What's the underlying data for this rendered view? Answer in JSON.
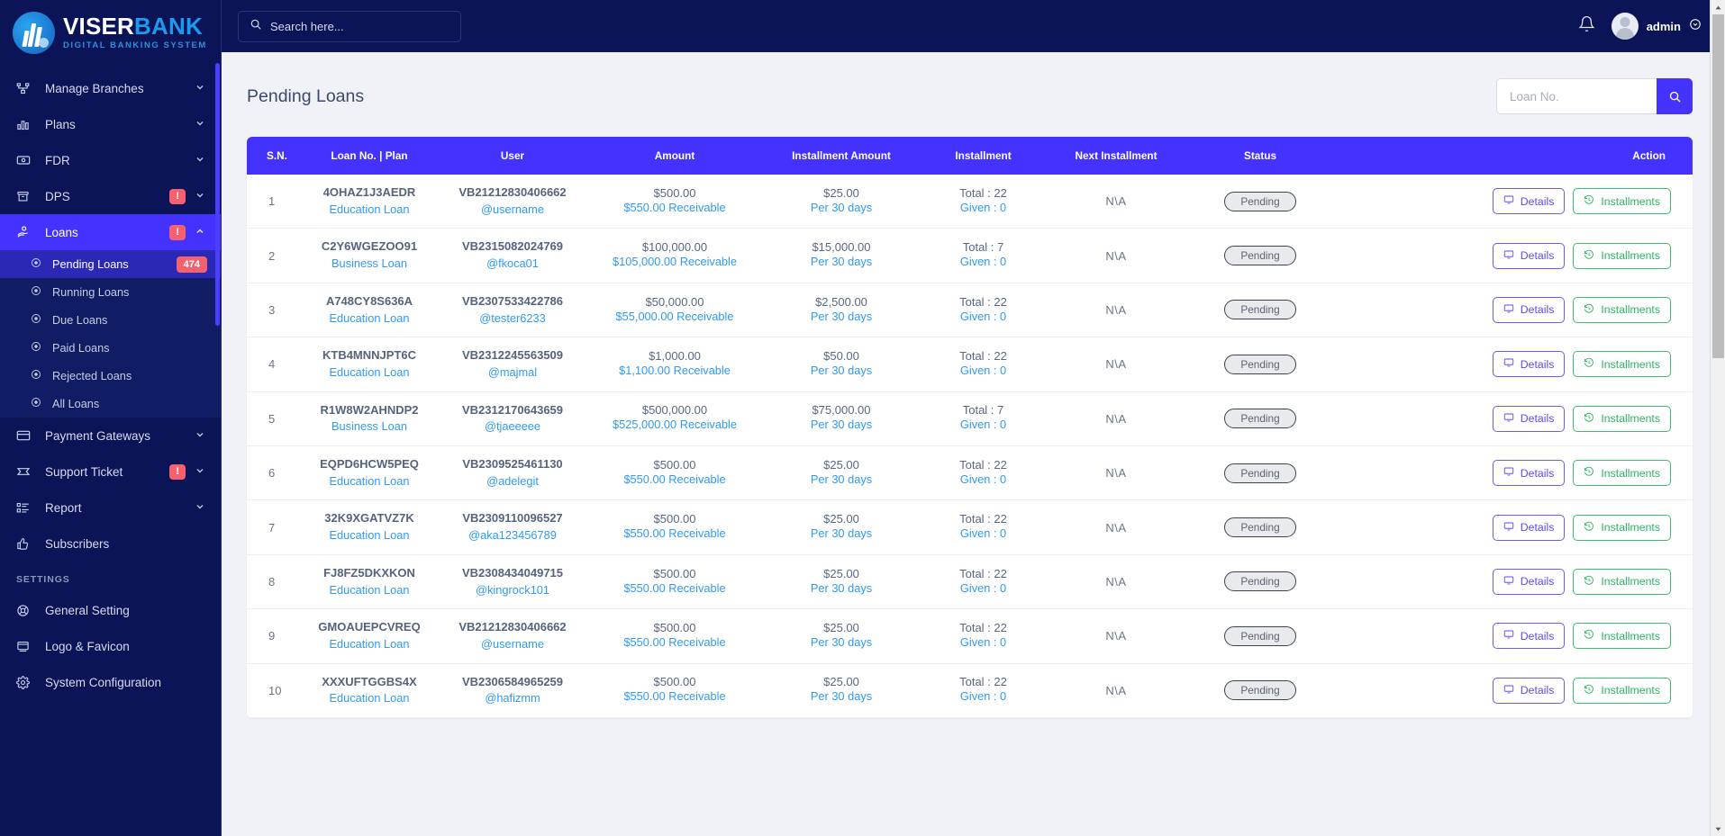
{
  "brand": {
    "word1": "VISER",
    "word2": "BANK",
    "tagline": "DIGITAL BANKING SYSTEM"
  },
  "topbar": {
    "search_placeholder": "Search here...",
    "user_name": "admin"
  },
  "sidebar": {
    "items": [
      {
        "label": "Manage Branches",
        "icon": "sitemap-icon",
        "chevron": true
      },
      {
        "label": "Plans",
        "icon": "bar-chart-icon",
        "chevron": true
      },
      {
        "label": "FDR",
        "icon": "money-icon",
        "chevron": true
      },
      {
        "label": "DPS",
        "icon": "archive-icon",
        "chevron": true,
        "alert": "!"
      },
      {
        "label": "Loans",
        "icon": "hand-coin-icon",
        "chevron": true,
        "alert": "!",
        "active": true
      }
    ],
    "loans_submenu": [
      {
        "label": "Pending Loans",
        "badge": "474",
        "current": true
      },
      {
        "label": "Running Loans"
      },
      {
        "label": "Due Loans"
      },
      {
        "label": "Paid Loans"
      },
      {
        "label": "Rejected Loans"
      },
      {
        "label": "All Loans"
      }
    ],
    "items_after": [
      {
        "label": "Payment Gateways",
        "icon": "credit-card-icon",
        "chevron": true
      },
      {
        "label": "Support Ticket",
        "icon": "ticket-icon",
        "chevron": true,
        "alert": "!"
      },
      {
        "label": "Report",
        "icon": "list-icon",
        "chevron": true
      },
      {
        "label": "Subscribers",
        "icon": "thumbs-up-icon"
      }
    ],
    "settings_title": "SETTINGS",
    "settings_items": [
      {
        "label": "General Setting",
        "icon": "lifebuoy-icon"
      },
      {
        "label": "Logo & Favicon",
        "icon": "window-icon"
      },
      {
        "label": "System Configuration",
        "icon": "gear-icon"
      }
    ]
  },
  "page": {
    "title": "Pending Loans",
    "loan_search_placeholder": "Loan No.",
    "loan_search_value": ""
  },
  "table": {
    "columns": [
      "S.N.",
      "Loan No. | Plan",
      "User",
      "Amount",
      "Installment Amount",
      "Installment",
      "Next Installment",
      "Status",
      "Action"
    ],
    "details_label": "Details",
    "installments_label": "Installments",
    "rows": [
      {
        "sn": "1",
        "loan_no": "4OHAZ1J3AEDR",
        "plan": "Education Loan",
        "user_id": "VB21212830406662",
        "username": "@username",
        "amount": "$500.00",
        "receivable": "$550.00 Receivable",
        "inst_amount": "$25.00",
        "inst_period": "Per 30 days",
        "inst_total": "Total : 22",
        "inst_given": "Given : 0",
        "next_installment": "N\\A",
        "status": "Pending"
      },
      {
        "sn": "2",
        "loan_no": "C2Y6WGEZOO91",
        "plan": "Business Loan",
        "user_id": "VB2315082024769",
        "username": "@fkoca01",
        "amount": "$100,000.00",
        "receivable": "$105,000.00 Receivable",
        "inst_amount": "$15,000.00",
        "inst_period": "Per 30 days",
        "inst_total": "Total : 7",
        "inst_given": "Given : 0",
        "next_installment": "N\\A",
        "status": "Pending"
      },
      {
        "sn": "3",
        "loan_no": "A748CY8S636A",
        "plan": "Education Loan",
        "user_id": "VB2307533422786",
        "username": "@tester6233",
        "amount": "$50,000.00",
        "receivable": "$55,000.00 Receivable",
        "inst_amount": "$2,500.00",
        "inst_period": "Per 30 days",
        "inst_total": "Total : 22",
        "inst_given": "Given : 0",
        "next_installment": "N\\A",
        "status": "Pending"
      },
      {
        "sn": "4",
        "loan_no": "KTB4MNNJPT6C",
        "plan": "Education Loan",
        "user_id": "VB2312245563509",
        "username": "@majmal",
        "amount": "$1,000.00",
        "receivable": "$1,100.00 Receivable",
        "inst_amount": "$50.00",
        "inst_period": "Per 30 days",
        "inst_total": "Total : 22",
        "inst_given": "Given : 0",
        "next_installment": "N\\A",
        "status": "Pending"
      },
      {
        "sn": "5",
        "loan_no": "R1W8W2AHNDP2",
        "plan": "Business Loan",
        "user_id": "VB2312170643659",
        "username": "@tjaeeeee",
        "amount": "$500,000.00",
        "receivable": "$525,000.00 Receivable",
        "inst_amount": "$75,000.00",
        "inst_period": "Per 30 days",
        "inst_total": "Total : 7",
        "inst_given": "Given : 0",
        "next_installment": "N\\A",
        "status": "Pending"
      },
      {
        "sn": "6",
        "loan_no": "EQPD6HCW5PEQ",
        "plan": "Education Loan",
        "user_id": "VB2309525461130",
        "username": "@adelegit",
        "amount": "$500.00",
        "receivable": "$550.00 Receivable",
        "inst_amount": "$25.00",
        "inst_period": "Per 30 days",
        "inst_total": "Total : 22",
        "inst_given": "Given : 0",
        "next_installment": "N\\A",
        "status": "Pending"
      },
      {
        "sn": "7",
        "loan_no": "32K9XGATVZ7K",
        "plan": "Education Loan",
        "user_id": "VB2309110096527",
        "username": "@aka123456789",
        "amount": "$500.00",
        "receivable": "$550.00 Receivable",
        "inst_amount": "$25.00",
        "inst_period": "Per 30 days",
        "inst_total": "Total : 22",
        "inst_given": "Given : 0",
        "next_installment": "N\\A",
        "status": "Pending"
      },
      {
        "sn": "8",
        "loan_no": "FJ8FZ5DKXKON",
        "plan": "Education Loan",
        "user_id": "VB2308434049715",
        "username": "@kingrock101",
        "amount": "$500.00",
        "receivable": "$550.00 Receivable",
        "inst_amount": "$25.00",
        "inst_period": "Per 30 days",
        "inst_total": "Total : 22",
        "inst_given": "Given : 0",
        "next_installment": "N\\A",
        "status": "Pending"
      },
      {
        "sn": "9",
        "loan_no": "GMOAUEPCVREQ",
        "plan": "Education Loan",
        "user_id": "VB21212830406662",
        "username": "@username",
        "amount": "$500.00",
        "receivable": "$550.00 Receivable",
        "inst_amount": "$25.00",
        "inst_period": "Per 30 days",
        "inst_total": "Total : 22",
        "inst_given": "Given : 0",
        "next_installment": "N\\A",
        "status": "Pending"
      },
      {
        "sn": "10",
        "loan_no": "XXXUFTGGBS4X",
        "plan": "Education Loan",
        "user_id": "VB2306584965259",
        "username": "@hafizmm",
        "amount": "$500.00",
        "receivable": "$550.00 Receivable",
        "inst_amount": "$25.00",
        "inst_period": "Per 30 days",
        "inst_total": "Total : 22",
        "inst_given": "Given : 0",
        "next_installment": "N\\A",
        "status": "Pending"
      }
    ]
  },
  "colors": {
    "accent": "#4433ff",
    "sidebar": "#0a1456",
    "link": "#2f9af5",
    "danger": "#f5616f",
    "success": "#2eb463"
  }
}
